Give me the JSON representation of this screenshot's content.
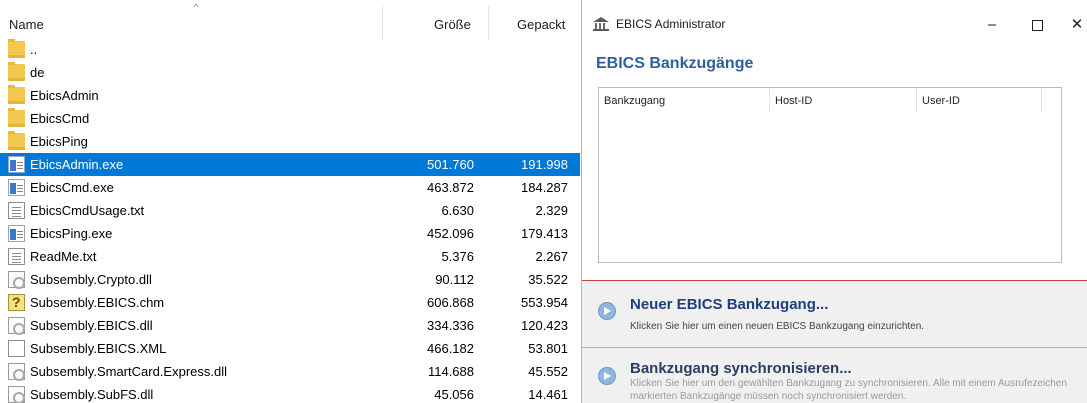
{
  "explorer": {
    "columns": {
      "name": "Name",
      "size": "Größe",
      "packed": "Gepackt"
    },
    "files": [
      {
        "name": "..",
        "type": "folder",
        "size": "",
        "packed": ""
      },
      {
        "name": "de",
        "type": "folder",
        "size": "",
        "packed": ""
      },
      {
        "name": "EbicsAdmin",
        "type": "folder",
        "size": "",
        "packed": ""
      },
      {
        "name": "EbicsCmd",
        "type": "folder",
        "size": "",
        "packed": ""
      },
      {
        "name": "EbicsPing",
        "type": "folder",
        "size": "",
        "packed": ""
      },
      {
        "name": "EbicsAdmin.exe",
        "type": "exe",
        "size": "501.760",
        "packed": "191.998",
        "selected": true
      },
      {
        "name": "EbicsCmd.exe",
        "type": "exe",
        "size": "463.872",
        "packed": "184.287"
      },
      {
        "name": "EbicsCmdUsage.txt",
        "type": "txt",
        "size": "6.630",
        "packed": "2.329"
      },
      {
        "name": "EbicsPing.exe",
        "type": "exe",
        "size": "452.096",
        "packed": "179.413"
      },
      {
        "name": "ReadMe.txt",
        "type": "txt",
        "size": "5.376",
        "packed": "2.267"
      },
      {
        "name": "Subsembly.Crypto.dll",
        "type": "dll",
        "size": "90.112",
        "packed": "35.522"
      },
      {
        "name": "Subsembly.EBICS.chm",
        "type": "chm",
        "size": "606.868",
        "packed": "553.954"
      },
      {
        "name": "Subsembly.EBICS.dll",
        "type": "dll",
        "size": "334.336",
        "packed": "120.423"
      },
      {
        "name": "Subsembly.EBICS.XML",
        "type": "xml",
        "size": "466.182",
        "packed": "53.801"
      },
      {
        "name": "Subsembly.SmartCard.Express.dll",
        "type": "dll",
        "size": "114.688",
        "packed": "45.552"
      },
      {
        "name": "Subsembly.SubFS.dll",
        "type": "dll",
        "size": "45.056",
        "packed": "14.461"
      }
    ],
    "selection_color": "#0078d7"
  },
  "window": {
    "title": "EBICS Administrator",
    "minimize": "–",
    "close": "✕",
    "heading": "EBICS Bankzugänge",
    "list_columns": {
      "bankzugang": "Bankzugang",
      "host_id": "Host-ID",
      "user_id": "User-ID"
    },
    "actions": [
      {
        "title": "Neuer EBICS Bankzugang...",
        "description": "Klicken Sie hier um einen neuen EBICS Bankzugang einzurichten.",
        "enabled": true
      },
      {
        "title": "Bankzugang synchronisieren...",
        "description": "Klicken Sie hier um den gewählten Bankzugang zu synchronisieren. Alle mit einem Ausrufezeichen markierten Bankzugänge müssen noch synchronisiert werden.",
        "enabled": false
      }
    ],
    "heading_color": "#2f5f9f",
    "accent_line_color": "#c7413b"
  }
}
